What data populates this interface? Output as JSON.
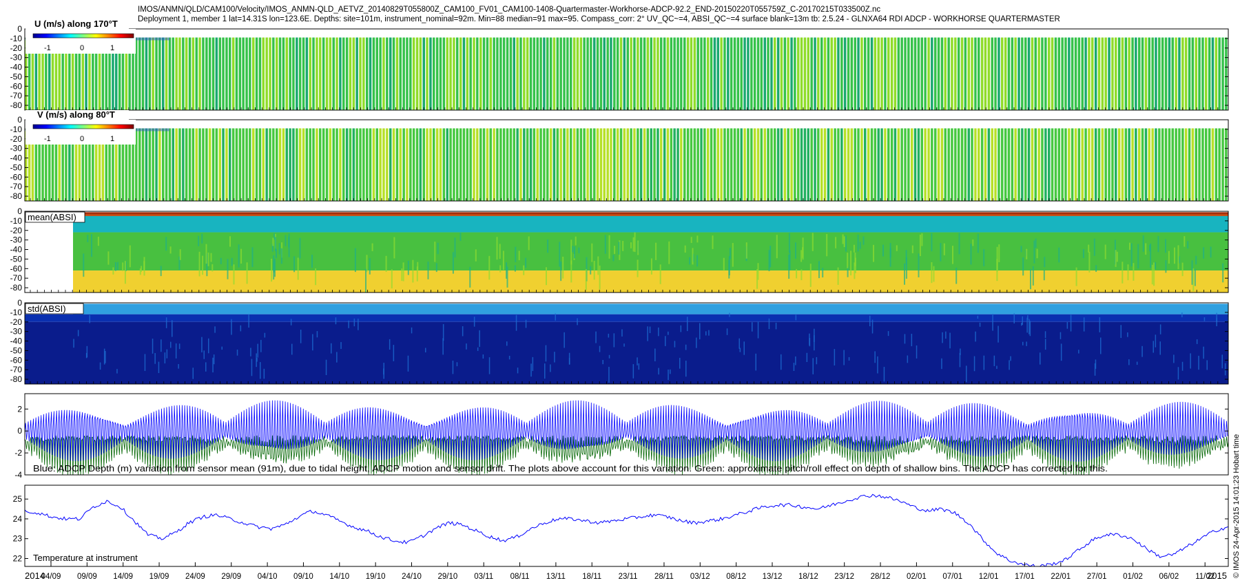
{
  "header": {
    "line1": "IMOS/ANMN/QLD/CAM100/Velocity/IMOS_ANMN-QLD_AETVZ_20140829T055800Z_CAM100_FV01_CAM100-1408-Quartermaster-Workhorse-ADCP-92.2_END-20150220T055759Z_C-20170215T033500Z.nc",
    "line2": "Deployment 1, member 1 lat=14.31S lon=123.6E. Depths: site=101m, instrument_nominal=92m. Min=88 median=91 max=95. Compass_corr: 2° UV_QC~=4, ABSI_QC~=4 surface blank=13m tb: 2.5.24 - GLNXA64 RDI ADCP - WORKHORSE QUARTERMASTER"
  },
  "side_label": "© IMOS 24-Apr-2015 14:01:23 Hobart time",
  "colorbar_ticks": [
    "-1",
    "0",
    "1"
  ],
  "panel_labels": {
    "u": "U (m/s) along 170°T",
    "v": "V (m/s) along 80°T",
    "mean_absi": "mean(ABSI)",
    "std_absi": "std(ABSI)",
    "depth_note": "Blue: ADCP Depth (m) variation from sensor mean (91m), due to tidal height, ADCP motion and sensor drift. The plots above account for this variation. Green: approximate pitch/roll effect on depth of shallow bins. The ADCP has corrected for this.",
    "temperature": "Temperature at instrument"
  },
  "x_axis": {
    "start_label": "2014",
    "end_label": "2015",
    "ticks": [
      "04/09",
      "09/09",
      "14/09",
      "19/09",
      "24/09",
      "29/09",
      "04/10",
      "09/10",
      "14/10",
      "19/10",
      "24/10",
      "29/10",
      "03/11",
      "08/11",
      "13/11",
      "18/11",
      "23/11",
      "28/11",
      "03/12",
      "08/12",
      "13/12",
      "18/12",
      "23/12",
      "28/12",
      "02/01",
      "07/01",
      "12/01",
      "17/01",
      "22/01",
      "27/01",
      "01/02",
      "06/02",
      "11/02"
    ]
  },
  "chart_data": [
    {
      "id": "u",
      "type": "heatmap",
      "title": "U (m/s) along 170°T",
      "ylim": [
        -85,
        0
      ],
      "yticks": [
        0,
        -10,
        -20,
        -30,
        -40,
        -50,
        -60,
        -70,
        -80
      ],
      "colorbar": {
        "range": [
          -1.5,
          1.5
        ],
        "ticks": [
          -1,
          0,
          1
        ]
      },
      "colors": {
        "base": "#36c24a",
        "mid": "#8fdc2a",
        "low": "#1aa870"
      }
    },
    {
      "id": "v",
      "type": "heatmap",
      "title": "V (m/s) along 80°T",
      "ylim": [
        -85,
        0
      ],
      "yticks": [
        0,
        -10,
        -20,
        -30,
        -40,
        -50,
        -60,
        -70,
        -80
      ],
      "colorbar": {
        "range": [
          -1.5,
          1.5
        ],
        "ticks": [
          -1,
          0,
          1
        ]
      },
      "colors": {
        "base": "#46c840",
        "mid": "#b6e028",
        "low": "#22b060"
      }
    },
    {
      "id": "mean_absi",
      "type": "heatmap",
      "title": "mean(ABSI)",
      "ylim": [
        -85,
        0
      ],
      "yticks": [
        0,
        -10,
        -20,
        -30,
        -40,
        -50,
        -60,
        -70,
        -80
      ],
      "colors": {
        "surface": "#c84a10",
        "upper": "#18b4c0",
        "middle": "#48c040",
        "lower": "#f0d030"
      }
    },
    {
      "id": "std_absi",
      "type": "heatmap",
      "title": "std(ABSI)",
      "ylim": [
        -85,
        0
      ],
      "yticks": [
        0,
        -10,
        -20,
        -30,
        -40,
        -50,
        -60,
        -70,
        -80
      ],
      "colors": {
        "top": "#30a0e0",
        "band": "#0a30b0",
        "body": "#0a1c8c",
        "streak": "#1c6ad0"
      }
    },
    {
      "id": "depth_variation",
      "type": "line",
      "ylim": [
        -4,
        3.4
      ],
      "yticks": [
        2,
        0,
        -2,
        -4
      ],
      "series": [
        {
          "color": "#0000ff",
          "description": "ADCP depth variation from sensor mean (m)"
        },
        {
          "color": "#006400",
          "description": "approximate pitch/roll effect on depth of shallow bins"
        }
      ]
    },
    {
      "id": "temperature",
      "type": "line",
      "title": "Temperature at instrument",
      "ylim": [
        21.6,
        25.7
      ],
      "yticks": [
        25,
        24,
        23,
        22
      ],
      "series": [
        {
          "color": "#0000ff",
          "x_days_from_start": [
            0,
            2,
            4,
            6,
            8,
            10,
            12,
            14,
            16,
            18,
            20,
            22,
            24,
            26,
            28,
            30,
            32,
            34,
            36,
            38,
            40,
            42,
            44,
            46,
            48,
            50,
            52,
            54,
            56,
            58,
            60,
            62,
            64,
            66,
            68,
            70,
            72,
            74,
            76,
            78,
            80,
            82,
            84,
            86,
            88,
            90,
            92,
            94,
            96,
            98,
            100,
            102,
            104,
            106,
            108,
            110,
            112,
            114,
            116,
            118,
            120,
            122,
            124,
            126,
            128,
            130,
            132,
            134,
            136,
            138,
            140,
            142,
            144,
            146,
            148,
            150,
            152,
            154,
            156,
            158,
            160,
            162,
            164,
            166,
            168,
            170,
            172,
            174,
            176
          ],
          "values": [
            24.4,
            24.3,
            24.1,
            24.0,
            24.0,
            24.6,
            24.9,
            24.6,
            23.9,
            23.2,
            23.0,
            23.3,
            23.8,
            24.1,
            24.2,
            24.0,
            23.8,
            23.6,
            23.5,
            23.7,
            24.1,
            24.4,
            24.2,
            23.9,
            23.6,
            23.4,
            23.1,
            22.9,
            22.8,
            23.1,
            23.5,
            23.8,
            23.7,
            23.4,
            23.1,
            22.9,
            23.1,
            23.5,
            23.8,
            24.0,
            24.0,
            23.9,
            23.8,
            23.9,
            24.0,
            24.1,
            24.2,
            24.1,
            23.9,
            23.8,
            23.9,
            24.0,
            24.2,
            24.4,
            24.6,
            24.7,
            24.7,
            24.6,
            24.5,
            24.7,
            24.9,
            25.1,
            25.2,
            25.1,
            24.9,
            24.6,
            24.4,
            24.5,
            24.3,
            23.8,
            23.0,
            22.3,
            21.9,
            21.7,
            21.6,
            21.7,
            21.9,
            22.4,
            22.9,
            23.2,
            23.2,
            23.0,
            22.5,
            22.1,
            22.2,
            22.6,
            23.0,
            23.4,
            23.6
          ]
        }
      ]
    }
  ]
}
